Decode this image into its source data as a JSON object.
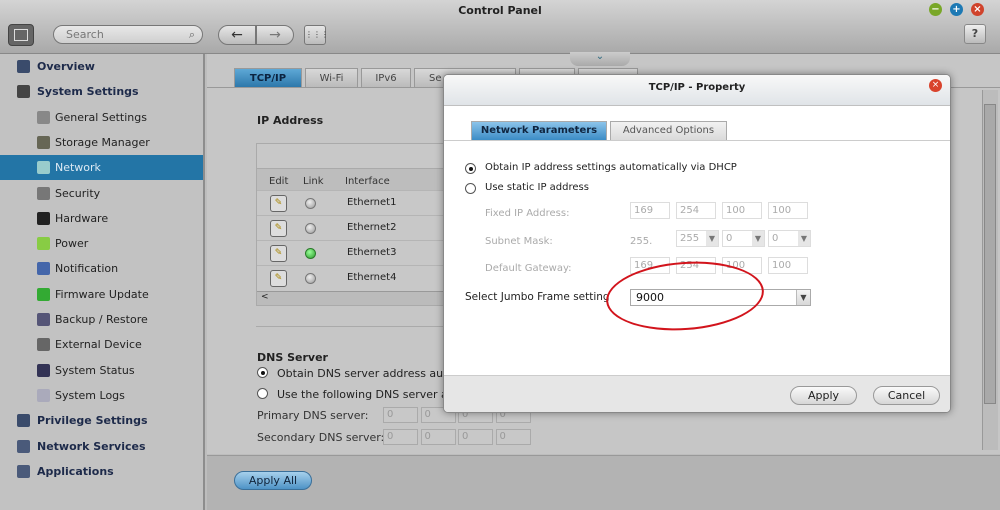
{
  "window": {
    "title": "Control Panel",
    "minimize": "−",
    "maximize": "+",
    "close": "×",
    "help": "?"
  },
  "toolbar": {
    "search_placeholder": "Search",
    "search_icon": "search-icon",
    "back": "←",
    "forward": "→",
    "apps": "⋮⋮⋮"
  },
  "sidebar": {
    "items": [
      {
        "label": "Overview",
        "level": "top",
        "icon": "grid-icon"
      },
      {
        "label": "System Settings",
        "level": "top",
        "icon": "gear-icon"
      },
      {
        "label": "General Settings",
        "level": "sub",
        "icon": "settings-icon"
      },
      {
        "label": "Storage Manager",
        "level": "sub",
        "icon": "storage-icon"
      },
      {
        "label": "Network",
        "level": "sub",
        "icon": "network-icon",
        "selected": true
      },
      {
        "label": "Security",
        "level": "sub",
        "icon": "lock-icon"
      },
      {
        "label": "Hardware",
        "level": "sub",
        "icon": "hardware-icon"
      },
      {
        "label": "Power",
        "level": "sub",
        "icon": "bulb-icon"
      },
      {
        "label": "Notification",
        "level": "sub",
        "icon": "notification-icon"
      },
      {
        "label": "Firmware Update",
        "level": "sub",
        "icon": "firmware-icon"
      },
      {
        "label": "Backup / Restore",
        "level": "sub",
        "icon": "backup-icon"
      },
      {
        "label": "External Device",
        "level": "sub",
        "icon": "drive-icon"
      },
      {
        "label": "System Status",
        "level": "sub",
        "icon": "monitor-icon"
      },
      {
        "label": "System Logs",
        "level": "sub",
        "icon": "logs-icon"
      },
      {
        "label": "Privilege Settings",
        "level": "top",
        "icon": "user-icon"
      },
      {
        "label": "Network Services",
        "level": "top",
        "icon": "globe-icon"
      },
      {
        "label": "Applications",
        "level": "top",
        "icon": "apps-icon"
      }
    ]
  },
  "main": {
    "tabs": [
      {
        "label": "TCP/IP",
        "active": true
      },
      {
        "label": "Wi-Fi"
      },
      {
        "label": "IPv6"
      },
      {
        "label": "Se"
      }
    ],
    "ip_section": "IP Address",
    "table": {
      "headers": [
        "Edit",
        "Link",
        "Interface"
      ],
      "rows": [
        {
          "interface": "Ethernet1",
          "link": "off"
        },
        {
          "interface": "Ethernet2",
          "link": "off"
        },
        {
          "interface": "Ethernet3",
          "link": "on"
        },
        {
          "interface": "Ethernet4",
          "link": "off"
        }
      ],
      "scroll_left": "<"
    },
    "dns": {
      "title": "DNS Server",
      "auto_label": "Obtain DNS server address autor",
      "manual_label": "Use the following DNS server adc",
      "primary_label": "Primary DNS server:",
      "secondary_label": "Secondary DNS server:",
      "primary": [
        "0",
        "0",
        "0",
        "0"
      ],
      "secondary": [
        "0",
        "0",
        "0",
        "0"
      ]
    },
    "apply_all": "Apply All",
    "collapse_icon": "⌄"
  },
  "dialog": {
    "title": "TCP/IP - Property",
    "close": "×",
    "tabs": [
      {
        "label": "Network Parameters",
        "active": true
      },
      {
        "label": "Advanced Options"
      }
    ],
    "dhcp_label": "Obtain IP address settings automatically via DHCP",
    "static_label": "Use static IP address",
    "mode": "dhcp",
    "fixed_ip_label": "Fixed IP Address:",
    "fixed_ip": [
      "169",
      "254",
      "100",
      "100"
    ],
    "subnet_label": "Subnet Mask:",
    "subnet_prefix": "255.",
    "subnet": [
      "255",
      "0",
      "0"
    ],
    "gateway_label": "Default Gateway:",
    "gateway": [
      "169",
      "254",
      "100",
      "100"
    ],
    "jumbo_label": "Select Jumbo Frame setting",
    "jumbo_value": "9000",
    "apply": "Apply",
    "cancel": "Cancel",
    "highlight_color": "#d2141c"
  }
}
